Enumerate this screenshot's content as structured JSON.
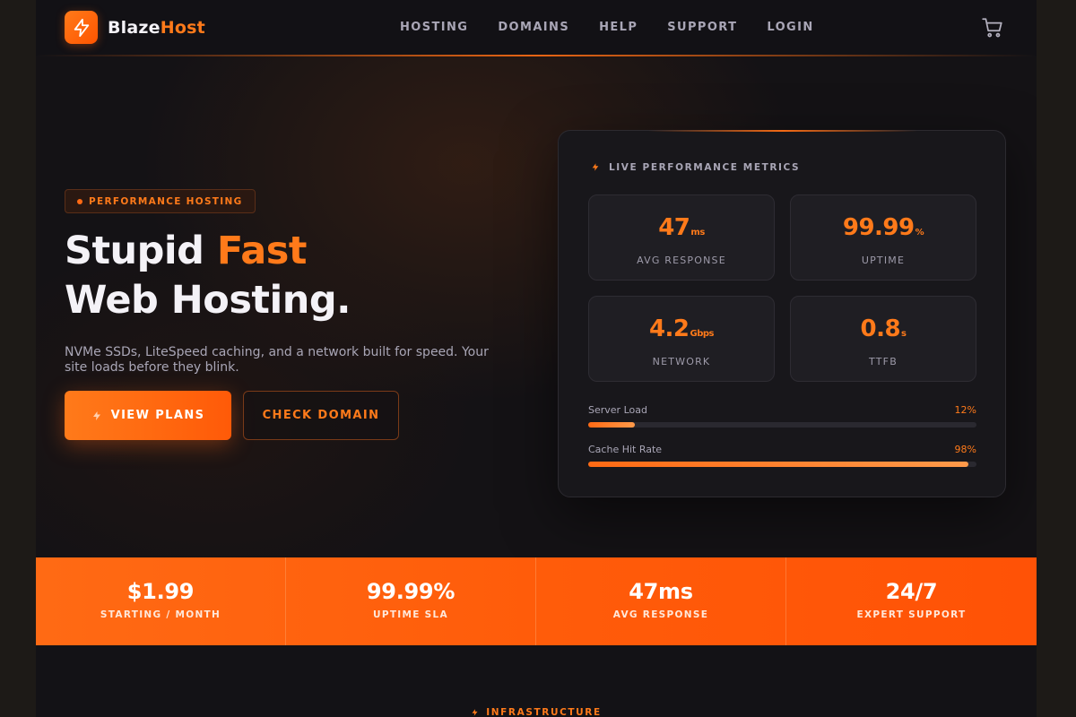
{
  "brand": {
    "name_part1": "Blaze",
    "name_part2": "Host",
    "icon": "lightning-bolt-icon",
    "accent_color": "#ff7a1a"
  },
  "nav": {
    "items": [
      {
        "label": "HOSTING"
      },
      {
        "label": "DOMAINS"
      },
      {
        "label": "HELP"
      },
      {
        "label": "SUPPORT"
      },
      {
        "label": "LOGIN"
      }
    ],
    "cart_icon": "shopping-cart-icon"
  },
  "hero": {
    "badge": "PERFORMANCE HOSTING",
    "headline_line1_a": "Stupid ",
    "headline_line1_b": "Fast",
    "headline_line2": "Web Hosting.",
    "subtitle": "NVMe SSDs, LiteSpeed caching, and a network built for speed. Your site loads before they blink.",
    "primary_cta": "VIEW PLANS",
    "secondary_cta": "CHECK DOMAIN"
  },
  "metrics": {
    "title": "LIVE PERFORMANCE METRICS",
    "tiles": [
      {
        "value": "47",
        "unit": "ms",
        "label": "AVG RESPONSE"
      },
      {
        "value": "99.99",
        "unit": "%",
        "label": "UPTIME"
      },
      {
        "value": "4.2",
        "unit": "Gbps",
        "label": "NETWORK"
      },
      {
        "value": "0.8",
        "unit": "s",
        "label": "TTFB"
      }
    ],
    "bars": [
      {
        "label": "Server Load",
        "percent_text": "12%",
        "percent": 12
      },
      {
        "label": "Cache Hit Rate",
        "percent_text": "98%",
        "percent": 98
      }
    ]
  },
  "stats": [
    {
      "value": "$1.99",
      "label": "STARTING / MONTH"
    },
    {
      "value": "99.99%",
      "label": "UPTIME SLA"
    },
    {
      "value": "47ms",
      "label": "AVG RESPONSE"
    },
    {
      "value": "24/7",
      "label": "EXPERT SUPPORT"
    }
  ],
  "next_section": {
    "eyebrow": "INFRASTRUCTURE"
  }
}
